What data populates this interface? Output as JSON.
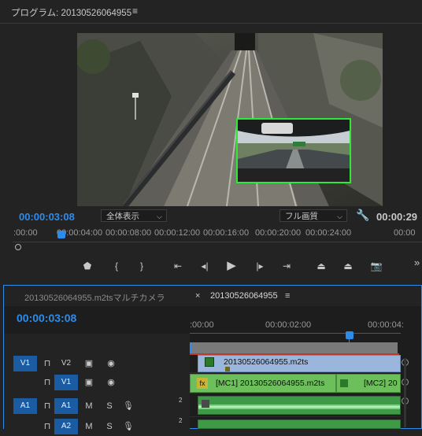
{
  "program": {
    "title": "プログラム: 20130526064955",
    "menu_icon": "hamburger-icon",
    "timecode": "00:00:03:08",
    "fit_dropdown": "全体表示",
    "quality_dropdown": "フル画質",
    "duration": "00:00:29",
    "ruler_labels": [
      ":00:00",
      "00:00:04:00",
      "00:00:08:00",
      "00:00:12:00",
      "00:00:16:00",
      "00:00:20:00",
      "00:00:24:00",
      "00:00"
    ],
    "transport": [
      "marker-icon",
      "mark-in-icon",
      "mark-out-icon",
      "go-to-in-icon",
      "step-back-icon",
      "play-icon",
      "step-forward-icon",
      "go-to-out-icon",
      "lift-icon",
      "extract-icon",
      "export-frame-icon"
    ],
    "more": "»"
  },
  "timeline": {
    "tab1": "20130526064955.m2tsマルチカメラ",
    "tab2_close": "×",
    "tab2": "20130526064955",
    "tab2_menu": "≡",
    "timecode": "00:00:03:08",
    "ruler_labels": [
      ":00:00",
      "00:00:02:00",
      "00:00:04:"
    ],
    "tracks": [
      {
        "target": "V1",
        "lock": "🔒",
        "name": "V2",
        "icons": [
          "film",
          "eye"
        ]
      },
      {
        "target": "",
        "lock": "🔒",
        "name": "V1",
        "icons": [
          "film",
          "eye"
        ]
      },
      {
        "target": "A1",
        "lock": "🔒",
        "name": "A1",
        "m": "M",
        "s": "S",
        "mic": "mic",
        "num": "2"
      },
      {
        "target": "",
        "lock": "🔒",
        "name": "A2",
        "m": "M",
        "s": "S",
        "mic": "mic",
        "num": "2"
      }
    ],
    "clips": {
      "v2": "20130526064955.m2ts",
      "v1a_fx": "fx",
      "v1a": "[MC1] 20130526064955.m2ts",
      "v1b": "[MC2] 20"
    }
  },
  "colors": {
    "accent": "#2d8ceb",
    "pip_border": "#2ee93a",
    "video_clip": "#9bb6dc",
    "mc_clip": "#6cbf5a"
  }
}
